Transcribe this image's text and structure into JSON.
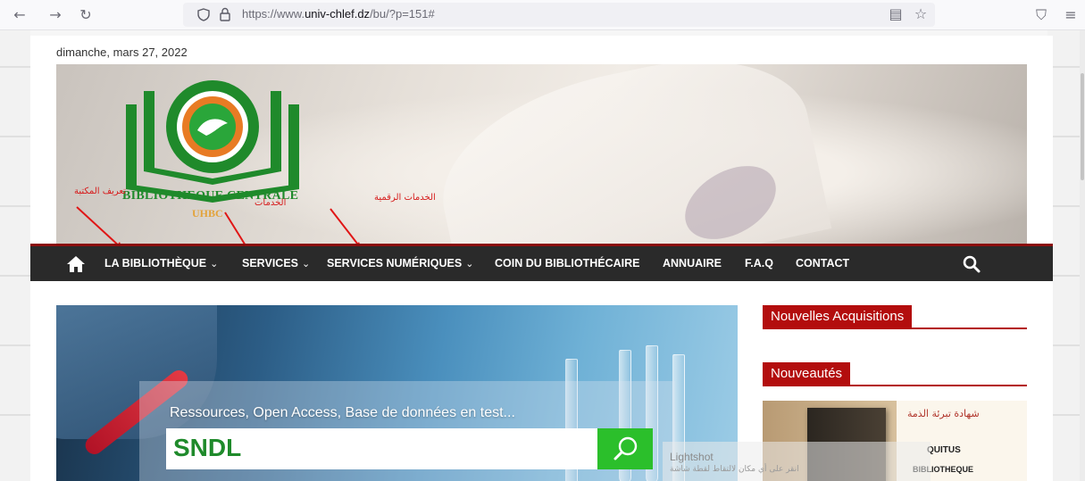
{
  "browser": {
    "url_prefix": "https://www.",
    "url_domain": "univ-chlef.dz",
    "url_path": "/bu/?p=151#",
    "back_icon": "←",
    "forward_icon": "→",
    "reload_icon": "↻",
    "menu_icon": "≡",
    "pocket_icon": "⛉",
    "star_icon": "☆",
    "reader_icon": "▤"
  },
  "site": {
    "date": "dimanche, mars 27, 2022",
    "logo_title": "BIBLIOTHEQUE CENTRALE",
    "logo_sub": "UHBC"
  },
  "annotations": {
    "about_library": "تعريف المكتبة",
    "services": "الخدمات",
    "digital_services": "الخدمات الرقمية"
  },
  "nav": {
    "items": [
      {
        "label": "LA BIBLIOTHÈQUE",
        "has_dropdown": true
      },
      {
        "label": "SERVICES",
        "has_dropdown": true
      },
      {
        "label": "SERVICES NUMÉRIQUES",
        "has_dropdown": true
      },
      {
        "label": "COIN DU BIBLIOTHÉCAIRE",
        "has_dropdown": false
      },
      {
        "label": "ANNUAIRE",
        "has_dropdown": false
      },
      {
        "label": "F.A.Q",
        "has_dropdown": false
      },
      {
        "label": "CONTACT",
        "has_dropdown": false
      }
    ],
    "chevron": "⌄"
  },
  "slider": {
    "caption": "Ressources, Open Access, Base de données en test...",
    "search_value": "SNDL"
  },
  "sidebar": {
    "widget1_title": "Nouvelles Acquisitions",
    "widget2_title": "Nouveautés",
    "thumb_arabic": "شهادة تبرئة الذمة",
    "thumb_line1": "QUITUS",
    "thumb_line2": "BIBLIOTHEQUE"
  },
  "popup": {
    "title": "Lightshot",
    "text": "انقر على أي مكان لالتقاط لقطة شاشة"
  },
  "colors": {
    "accent_red": "#b30d0d",
    "nav_bg": "#2a2a2a",
    "logo_green": "#1f8a2b",
    "search_green": "#2bbf2b"
  }
}
